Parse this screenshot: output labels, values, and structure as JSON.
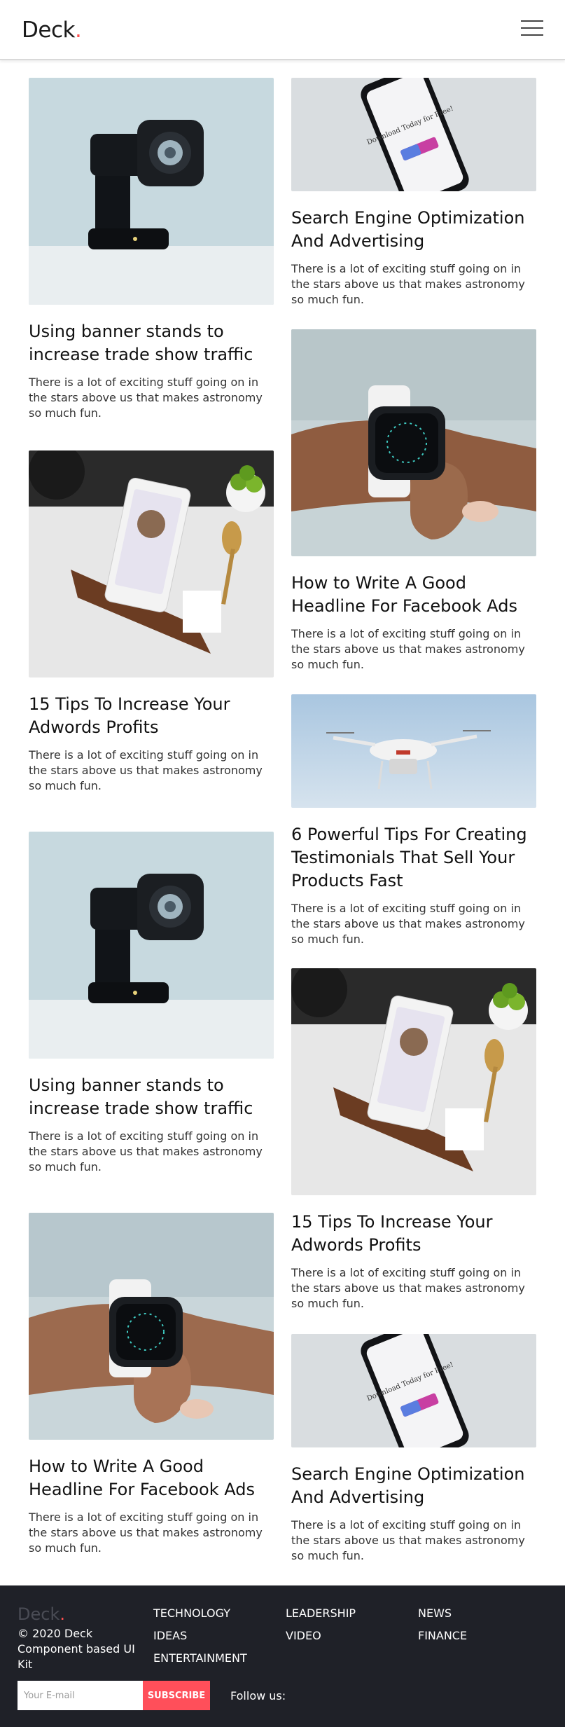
{
  "brand": {
    "name": "Deck",
    "dot": ".",
    "accent_color": "#ff4f4f"
  },
  "header": {
    "menu_icon": "hamburger-menu-icon"
  },
  "posts_left": [
    {
      "image": "camera-gimbal",
      "title": "Using banner stands to increase trade show traffic",
      "description": "There is a lot of exciting stuff going on in the stars above us that makes astronomy so much fun."
    },
    {
      "image": "tablet-kitchen",
      "title": "15 Tips To Increase Your Adwords Profits",
      "description": "There is a lot of exciting stuff going on in the stars above us that makes astronomy so much fun."
    },
    {
      "image": "camera-gimbal",
      "title": "Using banner stands to increase trade show traffic",
      "description": "There is a lot of exciting stuff going on in the stars above us that makes astronomy so much fun."
    },
    {
      "image": "smartwatch",
      "title": "How to Write A Good Headline For Facebook Ads",
      "description": "There is a lot of exciting stuff going on in the stars above us that makes astronomy so much fun."
    }
  ],
  "posts_right": [
    {
      "image": "phone-app",
      "title": "Search Engine Optimization And Advertising",
      "description": "There is a lot of exciting stuff going on in the stars above us that makes astronomy so much fun."
    },
    {
      "image": "smartwatch",
      "title": "How to Write A Good Headline For Facebook Ads",
      "description": "There is a lot of exciting stuff going on in the stars above us that makes astronomy so much fun."
    },
    {
      "image": "drone",
      "title": "6 Powerful Tips For Creating Testimonials That Sell Your Products Fast",
      "description": "There is a lot of exciting stuff going on in the stars above us that makes astronomy so much fun."
    },
    {
      "image": "tablet-kitchen",
      "title": "15 Tips To Increase Your Adwords Profits",
      "description": "There is a lot of exciting stuff going on in the stars above us that makes astronomy so much fun."
    },
    {
      "image": "phone-app",
      "title": "Search Engine Optimization And Advertising",
      "description": "There is a lot of exciting stuff going on in the stars above us that makes astronomy so much fun."
    }
  ],
  "phone_screen_text": "Download Today for Free!",
  "footer": {
    "logo": "Deck",
    "logo_dot": ".",
    "copyright": "© 2020 Deck Component based UI Kit",
    "links_col1": [
      "Technology",
      "Ideas",
      "Entertainment"
    ],
    "links_col2": [
      "Leadership",
      "Video"
    ],
    "links_col3": [
      "News",
      "Finance"
    ],
    "email_placeholder": "Your E-mail",
    "subscribe_label": "Subscribe",
    "follow_label": "Follow us:"
  },
  "colors": {
    "footer_bg": "#1f2128",
    "subscribe_bg": "#ff4f5a",
    "text_dark": "#111111"
  }
}
